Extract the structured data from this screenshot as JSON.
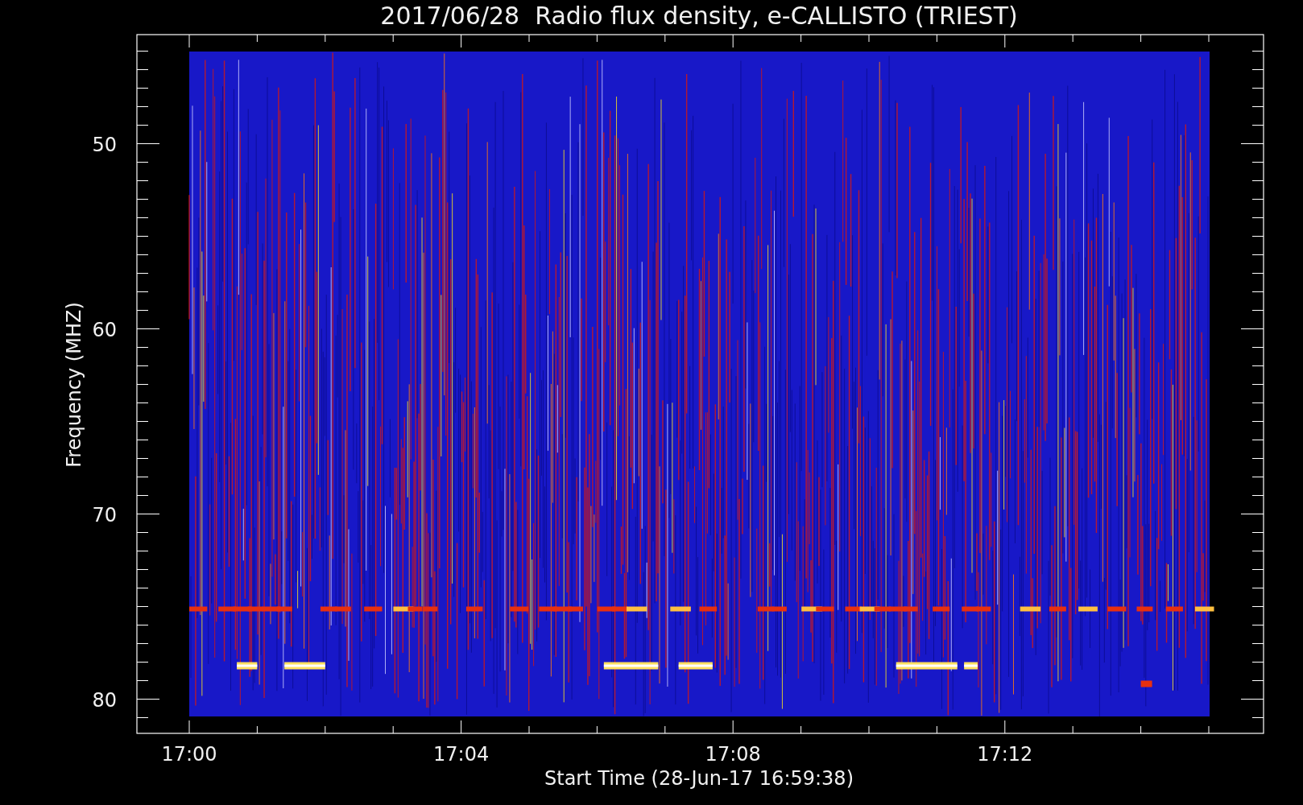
{
  "plot": {
    "title": "2017/06/28  Radio flux density, e-CALLISTO (TRIEST)",
    "xlabel": "Start Time (28-Jun-17 16:59:38)",
    "ylabel": "Frequency (MHZ)",
    "xticks": [
      "17:00",
      "17:04",
      "17:08",
      "17:12"
    ],
    "yticks": [
      "50",
      "60",
      "70",
      "80"
    ]
  }
}
